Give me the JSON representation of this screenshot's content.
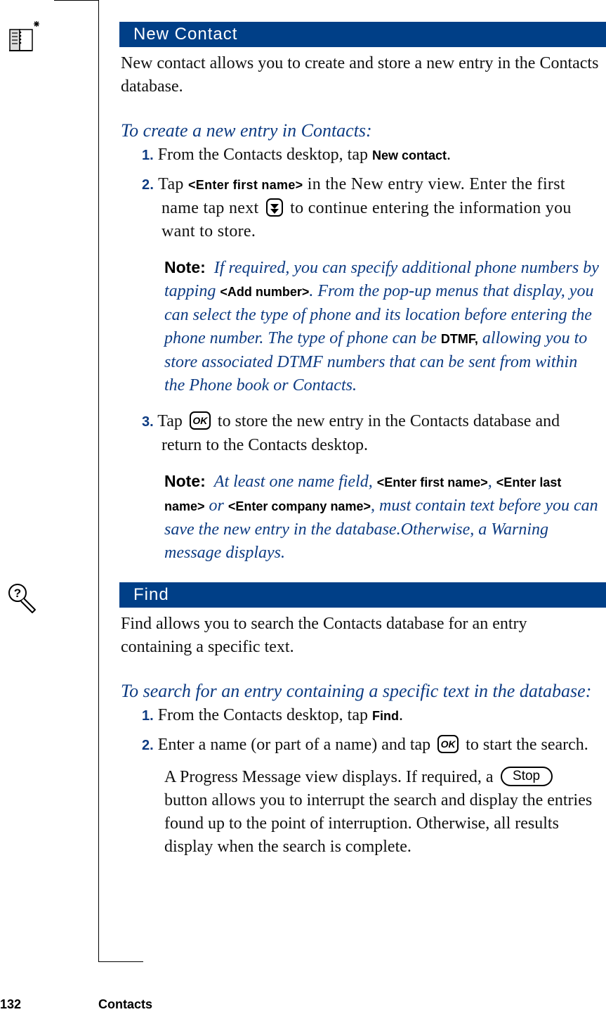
{
  "sections": {
    "new_contact": {
      "icon": "contacts-book-icon",
      "title": "New Contact",
      "intro": "New contact allows you to create and store a new entry in the Contacts database.",
      "procedure_title": "To create a new entry in Contacts:",
      "step1": {
        "num": "1.",
        "pre": "From the Contacts desktop, tap ",
        "ui": "New contact",
        "post": "."
      },
      "step2": {
        "num": "2.",
        "pre": "Tap ",
        "ui": "<Enter first name>",
        "mid": " in the New entry view. Enter the first name tap next ",
        "post": " to continue entering the information you want to store."
      },
      "note1": {
        "label": "Note:",
        "t1": "If required, you can specify additional phone numbers by tapping ",
        "ui1": "<Add number>",
        "t2": ". From the pop-up menus that display, you can select the type of phone and its location before entering the phone number. The type of phone can be ",
        "ui2": "DTMF,",
        "t3": " allowing you to store associated DTMF numbers that can be sent from within the Phone book or Contacts."
      },
      "step3": {
        "num": "3.",
        "pre": "Tap ",
        "button": "OK",
        "post": " to store the new entry in the Contacts database and return to the Contacts desktop."
      },
      "note2": {
        "label": "Note:",
        "t1": "At least one name field, ",
        "ui1": "<Enter first name>",
        "t2": ", ",
        "ui2": "<Enter last name>",
        "t3": " or ",
        "ui3": "<Enter company name>",
        "t4": ", must contain text before you can save the new entry in the database.Otherwise, a Warning message displays."
      }
    },
    "find": {
      "icon": "find-magnifier-icon",
      "title": "Find",
      "intro": "Find allows you to search the Contacts database for an entry containing a specific text.",
      "procedure_title": "To search for an entry containing a specific text in the database:",
      "step1": {
        "num": "1.",
        "pre": "From the Contacts desktop, tap ",
        "ui": "Find",
        "post": "."
      },
      "step2": {
        "num": "2.",
        "pre": "Enter a name (or part of a name) and tap ",
        "button": "OK",
        "post": " to start the search."
      },
      "para": {
        "pre": "A Progress Message view displays. If required, a ",
        "button": "Stop",
        "post": " button allows you to interrupt the search and display the entries found up to the point of interruption. Otherwise, all results display when the search is complete."
      }
    }
  },
  "footer": {
    "page_number": "132",
    "chapter": "Contacts"
  },
  "colors": {
    "header_bar": "#003f87",
    "accent_text": "#0d3b82"
  }
}
